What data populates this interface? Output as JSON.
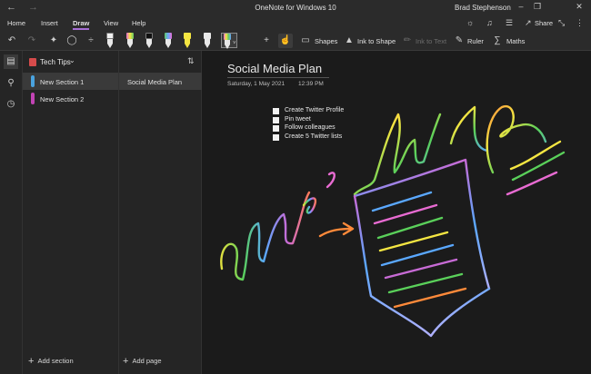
{
  "titlebar": {
    "back_icon": "back-arrow-icon",
    "forward_icon": "forward-arrow-icon",
    "title": "OneNote for Windows 10",
    "user": "Brad Stephenson"
  },
  "menu": {
    "tabs": [
      "Home",
      "Insert",
      "Draw",
      "View",
      "Help"
    ],
    "active": "Draw",
    "share_label": "Share"
  },
  "toolbar": {
    "shapes_label": "Shapes",
    "ink_to_shape_label": "Ink to Shape",
    "ink_to_text_label": "Ink to Text",
    "ruler_label": "Ruler",
    "maths_label": "Maths",
    "pens": [
      {
        "name": "pen-white-glitter",
        "color": "#f0f0f0"
      },
      {
        "name": "pen-rainbow-1",
        "color": "#e86bd2"
      },
      {
        "name": "pen-black",
        "color": "#1a1a1a"
      },
      {
        "name": "pen-rainbow-2",
        "color": "#64c864"
      },
      {
        "name": "pen-dark",
        "color": "#2a2a2a"
      },
      {
        "name": "highlighter-yellow",
        "color": "#f5e642"
      },
      {
        "name": "highlighter-white",
        "color": "#e8e8e8"
      },
      {
        "name": "pen-rainbow-selected",
        "color": "#6aa6ff"
      }
    ]
  },
  "notebook": {
    "name": "Tech Tips",
    "sections": [
      {
        "label": "New Section 1",
        "color": "#4aa3df"
      },
      {
        "label": "New Section 2",
        "color": "#c243b4"
      }
    ],
    "add_section_label": "Add section",
    "add_page_label": "Add page",
    "pages": [
      "Social Media Plan"
    ]
  },
  "page": {
    "title": "Social Media Plan",
    "date": "Saturday, 1 May 2021",
    "time": "12:39 PM",
    "todos": [
      "Create Twitter Profile",
      "Pin tweet",
      "Follow colleagues",
      "Create 5 Twitter lists"
    ]
  }
}
